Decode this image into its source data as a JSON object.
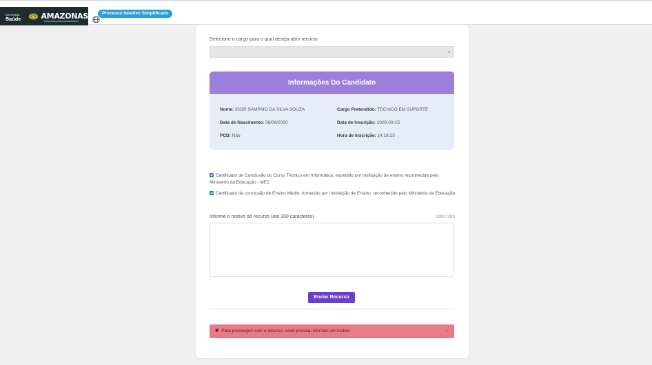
{
  "header": {
    "logo": {
      "secretaria": "Secretaria de",
      "saude": "Saúde",
      "amazonas": "AMAZONAS"
    },
    "pill_label": "Processo Seletivo Simplificado"
  },
  "form": {
    "select_label": "Selecione o cargo para o qual deseja abrir recurso",
    "select_value": ""
  },
  "candidate": {
    "title": "Informações Do Candidato",
    "fields": {
      "nome": {
        "label": "Nome:",
        "value": "IGOR SAMPAIO DA SILVA SOUZA"
      },
      "cargo": {
        "label": "Cargo Pretendido:",
        "value": "TECNICO EM SUPORTE"
      },
      "nascimento": {
        "label": "Data de Nascimento:",
        "value": "06/06/2000"
      },
      "inscricao": {
        "label": "Data de Inscrição:",
        "value": "2026-03-25"
      },
      "pcd": {
        "label": "PCD:",
        "value": "Não"
      },
      "hora": {
        "label": "Hora de Inscrição:",
        "value": "14:18:25"
      }
    }
  },
  "documents": [
    {
      "checked": true,
      "text": "Certificado de Conclusão do Curso Técnico em Informática, expedido por instituição de ensino reconhecida pelo Ministério da Educação - MEC"
    },
    {
      "checked": true,
      "text": "Certificado de conclusão de Ensino Médio, fornecido por Instituição de Ensino, reconhecido pelo Ministério da Educação."
    }
  ],
  "motivo": {
    "label": "Informe o motivo do recurso (até 200 caracteres)",
    "counter": "200 / 200",
    "value": ""
  },
  "submit_label": "Enviar Recurso",
  "alert": {
    "icon": "✖",
    "message": "Para prosseguir com o recurso, você precisa informar um motivo",
    "close": "×"
  },
  "colors": {
    "accent": "#6b3fc9",
    "info_header": "#9b7fdb",
    "info_bg": "#e6edf8",
    "pill": "#2b9fd8",
    "alert_bg": "#e87b85"
  }
}
